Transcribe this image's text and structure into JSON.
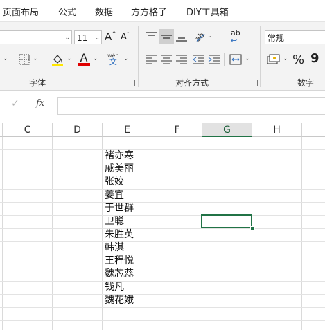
{
  "tabs": [
    "页面布局",
    "公式",
    "数据",
    "方方格子",
    "DIY工具箱"
  ],
  "ribbon": {
    "font": {
      "font_size": "11",
      "grow_label": "A",
      "shrink_label": "A",
      "wen_top": "wén",
      "wen_bottom": "文",
      "fill_color": "#ffe600",
      "font_color": "#e00000",
      "font_color_label": "A",
      "group_label": "字体"
    },
    "align": {
      "wrap_label": "ab",
      "group_label": "对齐方式"
    },
    "number": {
      "format_value": "常规",
      "percent": "%",
      "comma": "9",
      "group_label": "数字"
    }
  },
  "formula_bar": {
    "cancel_icon": "check-icon",
    "fx_label": "fx",
    "value": ""
  },
  "columns": [
    "C",
    "D",
    "E",
    "F",
    "G",
    "H"
  ],
  "selected_column": "G",
  "accent_color": "#217346",
  "column_e_values": [
    "褚亦寒",
    "戚美丽",
    "张姣",
    "姜宜",
    "于世群",
    "卫聪",
    "朱胜英",
    "韩淇",
    "王程悦",
    "魏芯蕊",
    "钱凡",
    "魏花娥"
  ]
}
